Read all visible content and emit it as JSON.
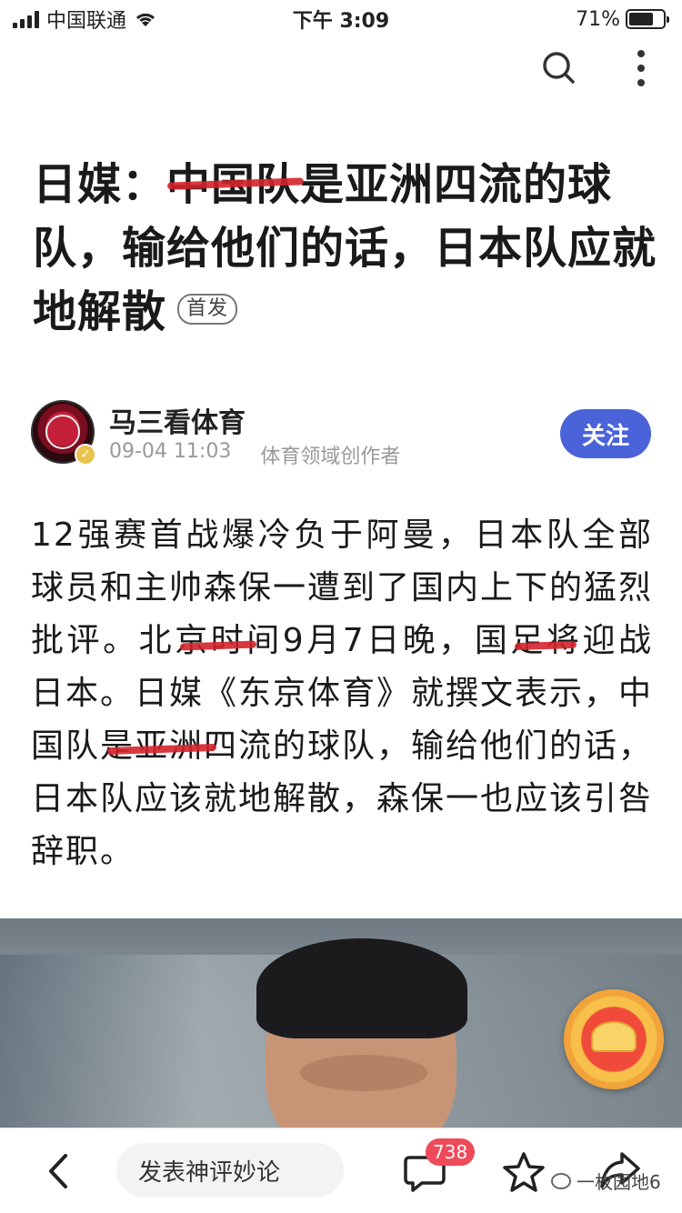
{
  "status_bar": {
    "carrier": "中国联通",
    "time": "下午 3:09",
    "battery_text": "71%",
    "battery_level": 0.71
  },
  "top_bar": {
    "icons": [
      "search-icon",
      "more-vertical-icon"
    ]
  },
  "article": {
    "title": "日媒：中国队是亚洲四流的球队，输给他们的话，日本队应就地解散",
    "title_badge": "首发",
    "author": {
      "name": "马三看体育",
      "date": "09-04 11:03",
      "tag": "体育领域创作者",
      "follow_label": "关注"
    },
    "body": "12强赛首战爆冷负于阿曼，日本队全部球员和主帅森保一遭到了国内上下的猛烈批评。北京时间9月7日晚，国足将迎战日本。日媒《东京体育》就撰文表示，中国队是亚洲四流的球队，输给他们的话，日本队应该就地解散，森保一也应该引咎辞职。"
  },
  "bottom_bar": {
    "comment_placeholder": "发表神评妙论",
    "comment_count": "738",
    "watermark": "一枚园地6"
  },
  "colors": {
    "accent": "#4a63d8",
    "badge_red": "#ef4a5a",
    "scribble": "#d4232b"
  }
}
